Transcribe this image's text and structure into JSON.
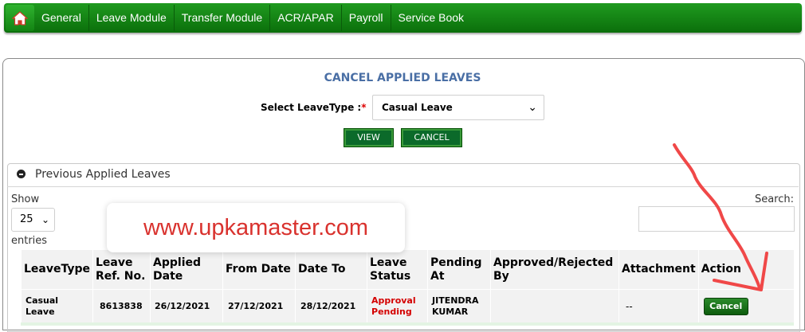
{
  "nav": {
    "items": [
      "General",
      "Leave Module",
      "Transfer Module",
      "ACR/APAR",
      "Payroll",
      "Service Book"
    ]
  },
  "form": {
    "title": "CANCEL APPLIED LEAVES",
    "select_label": "Select LeaveType :",
    "required_mark": "*",
    "select_value": "Casual Leave",
    "view_label": "VIEW",
    "cancel_label": "CANCEL"
  },
  "previous": {
    "title": "Previous Applied Leaves",
    "show_label": "Show",
    "page_length": "25",
    "entries_label": "entries",
    "search_label": "Search:"
  },
  "table": {
    "headers": {
      "leave_type": "LeaveType",
      "ref_line1": "Leave",
      "ref_line2": "Ref. No.",
      "applied_line1": "Applied",
      "applied_line2": "Date",
      "from_date": "From Date",
      "date_to": "Date To",
      "status_line1": "Leave",
      "status_line2": "Status",
      "pending_line1": "Pending",
      "pending_line2": "At",
      "approved_line1": "Approved/Rejected",
      "approved_line2": "By",
      "attachment": "Attachment",
      "action": "Action"
    },
    "rows": [
      {
        "type_line1": "Casual",
        "type_line2": "Leave",
        "ref_no": "8613838",
        "applied_date": "26/12/2021",
        "from_date": "27/12/2021",
        "date_to": "28/12/2021",
        "status_line1": "Approval",
        "status_line2": "Pending",
        "pending_line1": "JITENDRA",
        "pending_line2": "KUMAR",
        "approved_by": "",
        "attachment": "--",
        "action_label": "Cancel"
      }
    ]
  },
  "watermark": {
    "text": "www.upkamaster.com"
  },
  "colors": {
    "nav_green": "#128312",
    "button_green": "#0b6a2a",
    "title_blue": "#4a6fa5",
    "status_red": "#d40000",
    "annotation_red": "#f04848"
  }
}
